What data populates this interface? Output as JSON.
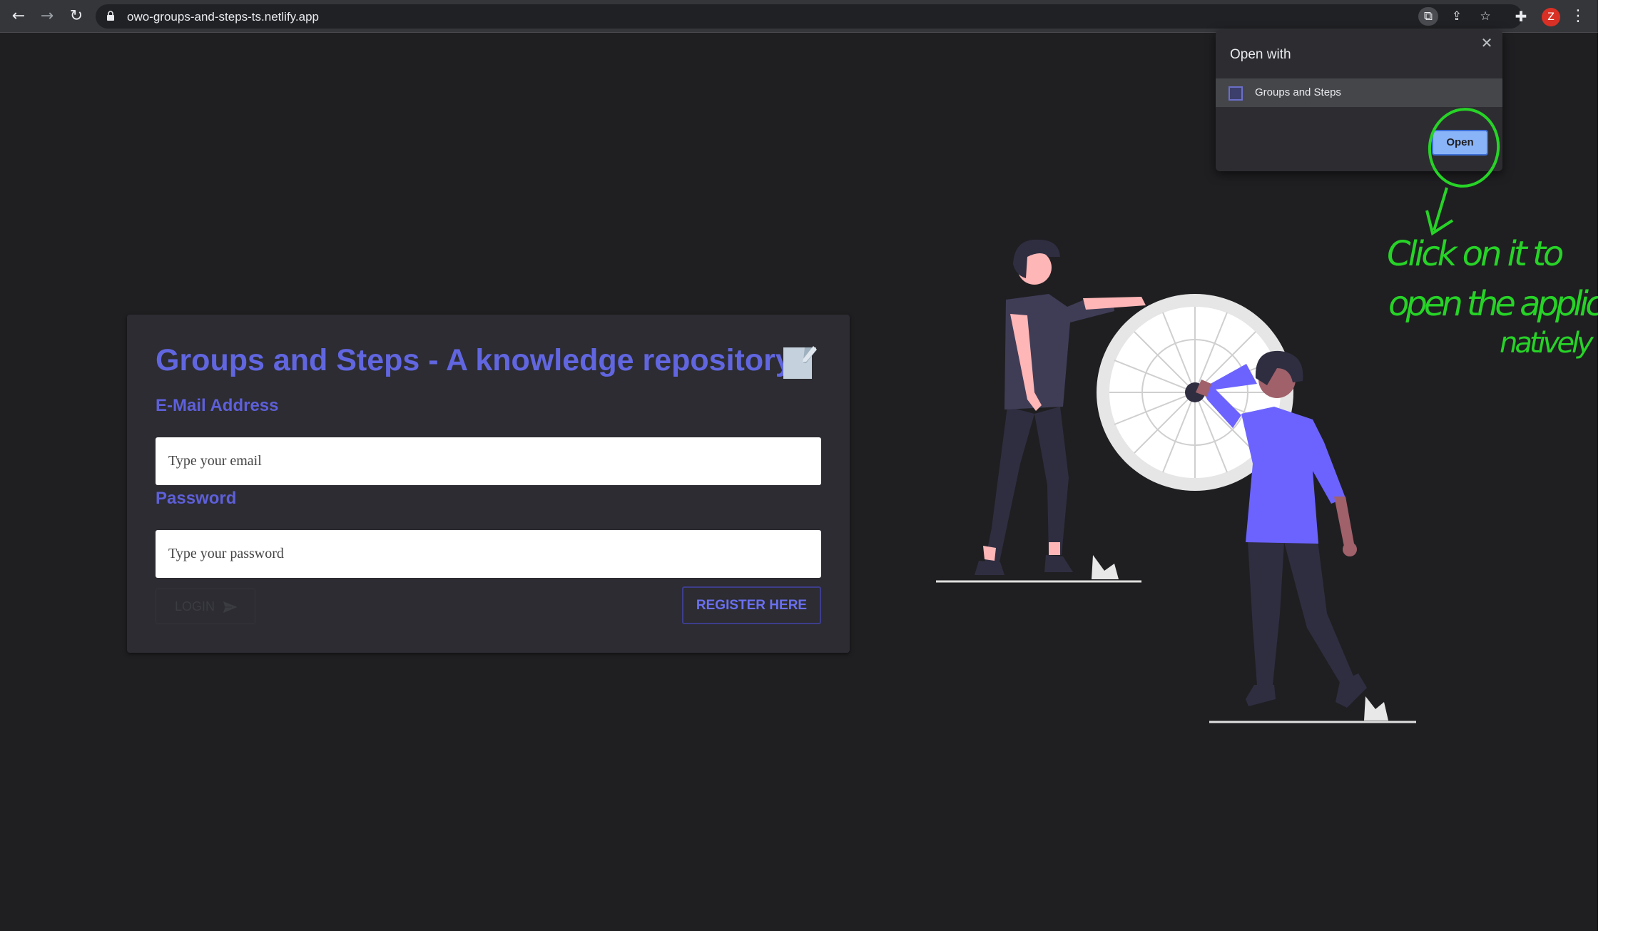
{
  "browser": {
    "url": "owo-groups-and-steps-ts.netlify.app",
    "profile_initial": "Z",
    "icons": {
      "back": "back-arrow-icon",
      "forward": "forward-arrow-icon",
      "reload": "reload-icon",
      "lock": "lock-icon",
      "open_in_app": "open-in-app-icon",
      "share": "share-icon",
      "bookmark": "star-icon",
      "extensions": "puzzle-icon",
      "menu": "kebab-menu-icon"
    }
  },
  "popup": {
    "title": "Open with",
    "item_label": "Groups and Steps",
    "open_button": "Open",
    "close_icon": "close-icon"
  },
  "login": {
    "title": "Groups and Steps - A knowledge repository",
    "title_icon": "memo-icon",
    "email_label": "E-Mail Address",
    "email_placeholder": "Type your email",
    "password_label": "Password",
    "password_placeholder": "Type your password",
    "login_button": "LOGIN",
    "register_button": "REGISTER HERE"
  },
  "annotation": {
    "line1": "Click on it to",
    "line2": "open the application",
    "line3": "natively"
  },
  "colors": {
    "page_bg": "#1f1f22",
    "card_bg": "#2c2c32",
    "accent": "#6166e0",
    "annotation_green": "#27d327",
    "open_button": "#8ab4f8"
  }
}
